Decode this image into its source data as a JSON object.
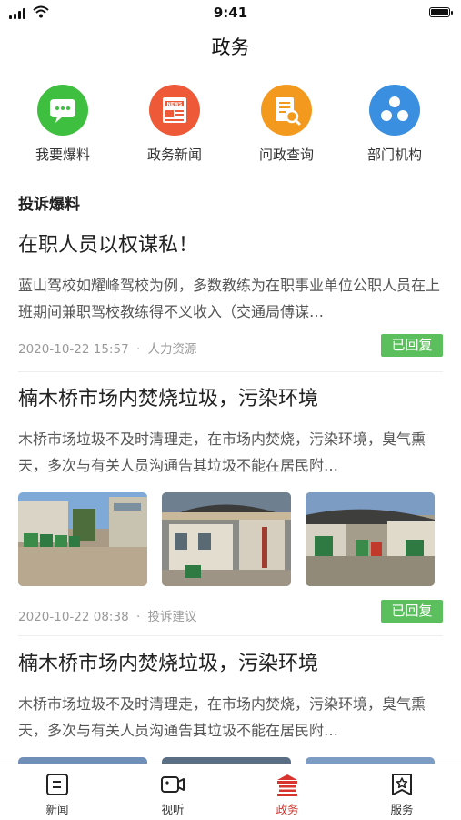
{
  "status": {
    "time": "9:41"
  },
  "header": {
    "title": "政务"
  },
  "quick_actions": [
    {
      "label": "我要爆料",
      "icon": "chat-bubble-icon",
      "color": "#3fbf3f"
    },
    {
      "label": "政务新闻",
      "icon": "news-icon",
      "color": "#ee5a37"
    },
    {
      "label": "问政查询",
      "icon": "document-search-icon",
      "color": "#f39a1e"
    },
    {
      "label": "部门机构",
      "icon": "organization-icon",
      "color": "#3a8fe0"
    }
  ],
  "section": {
    "title": "投诉爆料"
  },
  "posts": [
    {
      "title": "在职人员以权谋私！",
      "body": "蓝山驾校如耀峰驾校为例，多数教练为在职事业单位公职人员在上班期间兼职驾校教练得不义收入（交通局傅谋…",
      "date": "2020-10-22 15:57",
      "category": "人力资源",
      "status": "已回复"
    },
    {
      "title": "楠木桥市场内焚烧垃圾，污染环境",
      "body": "木桥市场垃圾不及时清理走，在市场内焚烧，污染环境，臭气熏天，多次与有关人员沟通告其垃圾不能在居民附…",
      "date": "2020-10-22 08:38",
      "category": "投诉建议",
      "status": "已回复"
    },
    {
      "title": "楠木桥市场内焚烧垃圾，污染环境",
      "body": "木桥市场垃圾不及时清理走，在市场内焚烧，污染环境，臭气熏天，多次与有关人员沟通告其垃圾不能在居民附…"
    }
  ],
  "meta_separator": "·",
  "tabs": [
    {
      "label": "新闻",
      "icon": "news-tab-icon"
    },
    {
      "label": "视听",
      "icon": "video-tab-icon"
    },
    {
      "label": "政务",
      "icon": "government-tab-icon",
      "active": true
    },
    {
      "label": "服务",
      "icon": "service-tab-icon"
    }
  ],
  "colors": {
    "accent": "#d8342d",
    "badge": "#5cbf5d"
  }
}
